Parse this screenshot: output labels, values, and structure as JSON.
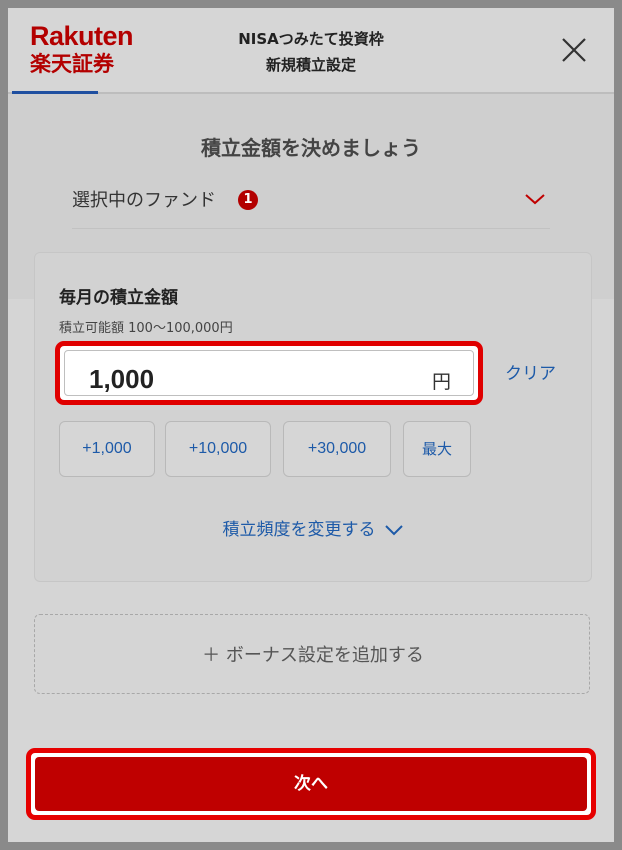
{
  "header": {
    "logo_en": "Rakuten",
    "logo_jp": "楽天証券",
    "title_line1": "NISAつみたて投資枠",
    "title_line2": "新規積立設定"
  },
  "section_title": "積立金額を決めましょう",
  "fund": {
    "label": "選択中のファンド",
    "count": "1"
  },
  "card": {
    "title": "毎月の積立金額",
    "range": "積立可能額 100〜100,000円",
    "amount_value": "1,000",
    "amount_unit": "円",
    "clear_label": "クリア",
    "quick_buttons": [
      "+1,000",
      "+10,000",
      "+30,000",
      "最大"
    ],
    "frequency_link": "積立頻度を変更する"
  },
  "bonus": {
    "label": "＋ ボーナス設定を追加する"
  },
  "footer": {
    "next_label": "次へ"
  },
  "colors": {
    "brand_red": "#b30000",
    "highlight_red": "#e00000",
    "link_blue": "#1d5aa8"
  },
  "icons": {
    "close": "close-icon",
    "fund_chevron": "chevron-down-icon",
    "freq_chevron": "chevron-down-icon"
  }
}
